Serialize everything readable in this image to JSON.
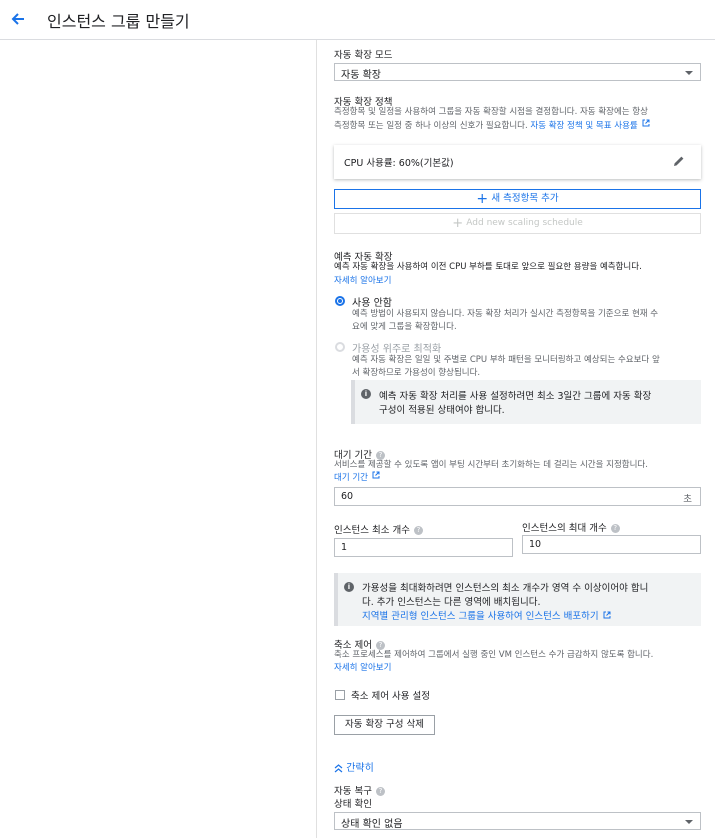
{
  "header": {
    "title": "인스턴스 그룹 만들기"
  },
  "autoscaling_mode": {
    "label": "자동 확장 모드",
    "value": "자동 확장"
  },
  "policy": {
    "label": "자동 확장 정책",
    "desc_line1": "측정항목 및 일정을 사용하여 그룹을 자동 확장할 시점을 결정합니다. 자동 확장에는 항상",
    "desc_line2": "측정항목 또는 일정 중 하나 이상의 신호가 필요합니다.",
    "link": "자동 확장 정책 및 목표 사용률",
    "metric": "CPU 사용률: 60%(기본값)",
    "add_metric": "새 측정항목 추가",
    "add_schedule": "Add new scaling schedule"
  },
  "predictive": {
    "label": "예측 자동 확장",
    "desc": "예측 자동 확장을 사용하여 이전 CPU 부하를 토대로 앞으로 필요한 용량을 예측합니다.",
    "learn_more": "자세히 알아보기",
    "opt_off_label": "사용 안함",
    "opt_off_desc1": "예측 방법이 사용되지 않습니다. 자동 확장 처리가 실시간 측정항목을 기준으로 현재 수",
    "opt_off_desc2": "요에 맞게 그룹을 확장합니다.",
    "opt_avail_label": "가용성 위주로 최적화",
    "opt_avail_desc1": "예측 자동 확장은 일일 및 주별로 CPU 부하 패턴을 모니터링하고 예상되는 수요보다 앞",
    "opt_avail_desc2": "서 확장하므로 가용성이 향상됩니다.",
    "note_line1": "예측 자동 확장 처리를 사용 설정하려면 최소 3일간 그룹에 자동 확장",
    "note_line2": "구성이 적용된 상태여야 합니다."
  },
  "cooldown": {
    "label": "대기 기간",
    "desc": "서비스를 제공할 수 있도록 앱이 부팅 시간부터 초기화하는 데 걸리는 시간을 지정합니다.",
    "link": "대기 기간",
    "value": "60",
    "unit": "초"
  },
  "instances": {
    "min_label": "인스턴스 최소 개수",
    "min_value": "1",
    "max_label": "인스턴스의 최대 개수",
    "max_value": "10",
    "note_line1": "가용성을 최대화하려면 인스턴스의 최소 개수가 영역 수 이상이어야 합니",
    "note_line2": "다. 추가 인스턴스는 다른 영역에 배치됩니다.",
    "note_link": "지역별 관리형 인스턴스 그룹을 사용하여 인스턴스 배포하기"
  },
  "scale_in": {
    "label": "축소 제어",
    "desc": "축소 프로세스를 제어하여 그룹에서 실행 중인 VM 인스턴스 수가 급감하지 않도록 합니다.",
    "learn_more": "자세히 알아보기",
    "checkbox_label": "축소 제어 사용 설정"
  },
  "delete_button": "자동 확장 구성 삭제",
  "collapse": "간략히",
  "autoheal": {
    "label": "자동 복구",
    "health_label": "상태 확인",
    "health_value": "상태 확인 없음"
  },
  "colors": {
    "accent": "#1a73e8",
    "text": "#202124",
    "muted": "#5f6368"
  }
}
